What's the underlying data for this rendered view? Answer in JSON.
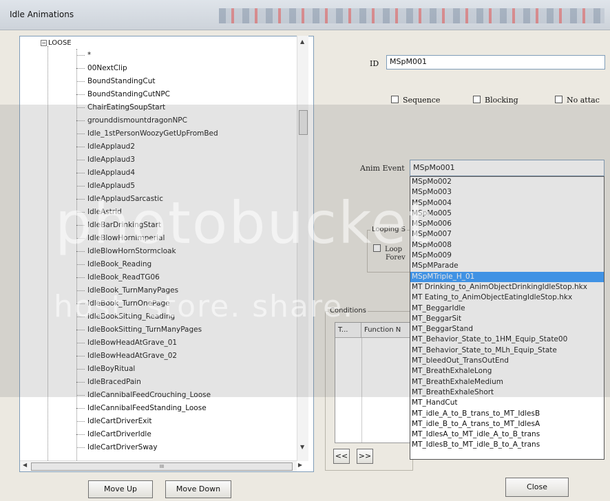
{
  "window": {
    "title": "Idle Animations"
  },
  "tree": {
    "root_label": "LOOSE",
    "items": [
      "*",
      "00NextClip",
      "BoundStandingCut",
      "BoundStandingCutNPC",
      "ChairEatingSoupStart",
      "grounddismountdragonNPC",
      "Idle_1stPersonWoozyGetUpFromBed",
      "IdleApplaud2",
      "IdleApplaud3",
      "IdleApplaud4",
      "IdleApplaud5",
      "IdleApplaudSarcastic",
      "IdleAstrid",
      "IdleBarDrinkingStart",
      "IdleBlowHornImperial",
      "IdleBlowHornStormcloak",
      "IdleBook_Reading",
      "IdleBook_ReadTG06",
      "IdleBook_TurnManyPages",
      "IdleBook_TurnOnePage",
      "IdleBookSitting_Reading",
      "IdleBookSitting_TurnManyPages",
      "IdleBowHeadAtGrave_01",
      "IdleBowHeadAtGrave_02",
      "IdleBoyRitual",
      "IdleBracedPain",
      "IdleCannibalFeedCrouching_Loose",
      "IdleCannibalFeedStanding_Loose",
      "IdleCartDriverExit",
      "IdleCartDriverIdle",
      "IdleCartDriverSway"
    ],
    "hscroll_grip": "III"
  },
  "form": {
    "id_label": "ID",
    "id_value": "MSpM001",
    "sequence_label": "Sequence",
    "blocking_label": "Blocking",
    "no_attack_label": "No attac",
    "anim_event_label": "Anim Event",
    "anim_event_value": "MSpMo001",
    "looping_group": "Looping S",
    "loop_label": "Loop",
    "forever_label": "Forev",
    "conditions_group": "Conditions",
    "col_t": "T...",
    "col_function": "Function N"
  },
  "dropdown_items": [
    "MSpMo002",
    "MSpMo003",
    "MSpMo004",
    "MSpMo005",
    "MSpMo006",
    "MSpMo007",
    "MSpMo008",
    "MSpMo009",
    "MSpMParade",
    "MSpMTriple_H_01",
    "MT Drinking_to_AnimObjectDrinkingIdleStop.hkx",
    "MT Eating_to_AnimObjectEatingIdleStop.hkx",
    "MT_BeggarIdle",
    "MT_BeggarSit",
    "MT_BeggarStand",
    "MT_Behavior_State_to_1HM_Equip_State00",
    "MT_Behavior_State_to_MLh_Equip_State",
    "MT_bleedOut_TransOutEnd",
    "MT_BreathExhaleLong",
    "MT_BreathExhaleMedium",
    "MT_BreathExhaleShort",
    "MT_HandCut",
    "MT_idle_A_to_B_trans_to_MT_IdlesB",
    "MT_idle_B_to_A_trans_to_MT_IdlesA",
    "MT_IdlesA_to_MT_idle_A_to_B_trans",
    "MT_IdlesB_to_MT_idle_B_to_A_trans"
  ],
  "selected_dropdown_index": 9,
  "buttons": {
    "prev": "<<",
    "next": ">>",
    "move_up": "Move Up",
    "move_down": "Move Down",
    "close": "Close"
  },
  "watermark": {
    "line1": "photobucket",
    "line2": "host. store. share."
  },
  "colors": {
    "selection": "#3399ff",
    "window_bg": "#ece9e1"
  }
}
